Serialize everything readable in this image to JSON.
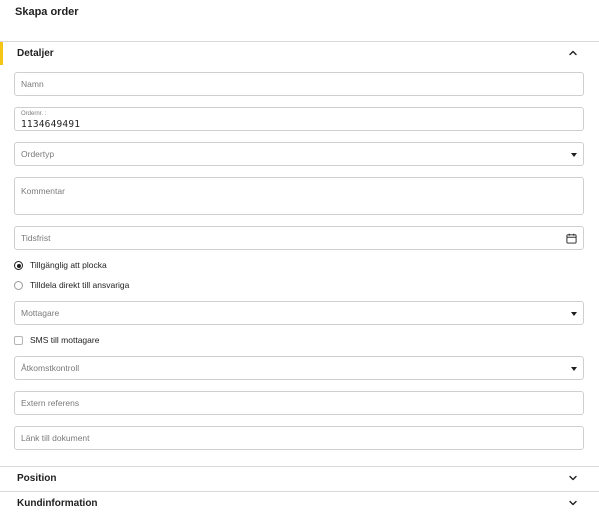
{
  "page": {
    "title": "Skapa order"
  },
  "sections": {
    "details": {
      "label": "Detaljer"
    },
    "position": {
      "label": "Position"
    },
    "customer": {
      "label": "Kundinformation"
    }
  },
  "form": {
    "name": {
      "placeholder": "Namn"
    },
    "order_number": {
      "label": "Ordernr. :",
      "value": "1134649491"
    },
    "order_type": {
      "placeholder": "Ordertyp"
    },
    "comment": {
      "placeholder": "Kommentar"
    },
    "deadline": {
      "placeholder": "Tidsfrist"
    },
    "availability": {
      "options": [
        {
          "label": "Tillgänglig att plocka",
          "selected": true
        },
        {
          "label": "Tilldela direkt till ansvariga",
          "selected": false
        }
      ]
    },
    "recipient": {
      "placeholder": "Mottagare"
    },
    "sms": {
      "label": "SMS till mottagare",
      "checked": false
    },
    "access_control": {
      "placeholder": "Åtkomstkontroll"
    },
    "external_ref": {
      "placeholder": "Extern referens"
    },
    "document_link": {
      "placeholder": "Länk till dokument"
    }
  },
  "colors": {
    "accent": "#f5c518",
    "border": "#cfcfcf",
    "text": "#1f1f1f"
  },
  "icons": {
    "details_toggle": "chevron-up-icon",
    "position_toggle": "chevron-down-icon",
    "customer_toggle": "chevron-down-icon",
    "deadline": "calendar-icon"
  }
}
